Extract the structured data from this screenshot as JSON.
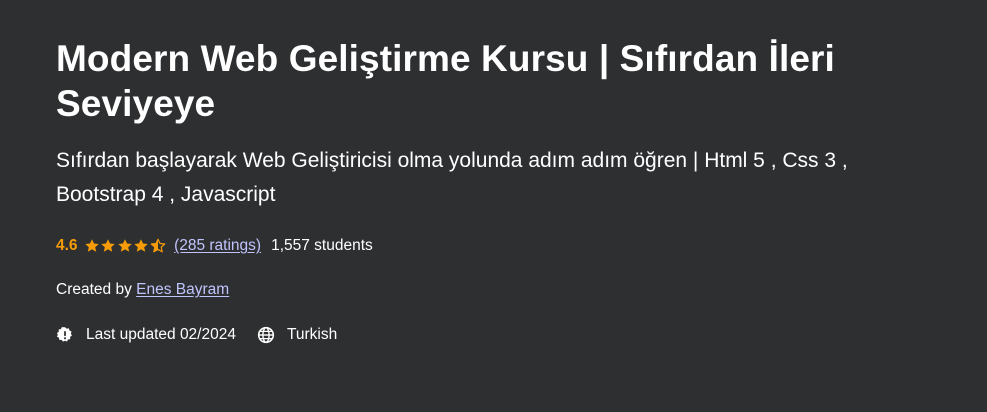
{
  "course": {
    "title": "Modern Web Geliştirme Kursu | Sıfırdan İleri Seviyeye",
    "subtitle": "Sıfırdan başlayarak Web Geliştiricisi olma yolunda adım adım öğren | Html 5 , Css 3 , Bootstrap 4 , Javascript"
  },
  "rating": {
    "value": "4.6",
    "stars_filled": 4.6,
    "stars_total": 5,
    "ratings_label": "(285 ratings)",
    "students_label": "1,557 students"
  },
  "creator": {
    "prefix": "Created by",
    "name": "Enes Bayram"
  },
  "meta": {
    "last_updated": "Last updated 02/2024",
    "language": "Turkish"
  },
  "colors": {
    "background": "#2d2f31",
    "rating_accent": "#f69c08",
    "link": "#c0c4fc",
    "text": "#ffffff"
  },
  "icons": {
    "updated": "alert-badge-icon",
    "language": "globe-icon",
    "star": "star-icon"
  }
}
